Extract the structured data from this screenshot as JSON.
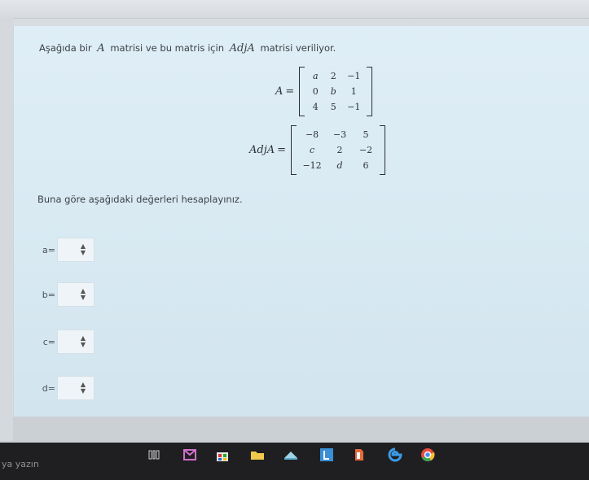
{
  "question": {
    "prefix": "Aşağıda bir",
    "var_a": "A",
    "middle": "matrisi ve bu matris için",
    "var_adj": "AdjA",
    "suffix": "matrisi veriliyor."
  },
  "matrix_a": {
    "label": "A",
    "rows": [
      [
        "a",
        "2",
        "−1"
      ],
      [
        "0",
        "b",
        "1"
      ],
      [
        "4",
        "5",
        "−1"
      ]
    ]
  },
  "matrix_adj": {
    "label": "AdjA",
    "rows": [
      [
        "−8",
        "−3",
        "5"
      ],
      [
        "c",
        "2",
        "−2"
      ],
      [
        "−12",
        "d",
        "6"
      ]
    ]
  },
  "prompt": "Buna göre aşağıdaki değerleri hesaplayınız.",
  "answers": [
    {
      "label": "a=",
      "value": ""
    },
    {
      "label": "b=",
      "value": ""
    },
    {
      "label": "c=",
      "value": ""
    },
    {
      "label": "d=",
      "value": ""
    }
  ],
  "taskbar": {
    "search_placeholder": "ya yazın",
    "icons": [
      "task-view-icon",
      "mail-icon",
      "store-icon",
      "file-explorer-icon",
      "weather-icon",
      "office-icon",
      "docs-icon",
      "edge-icon",
      "chrome-icon"
    ]
  }
}
